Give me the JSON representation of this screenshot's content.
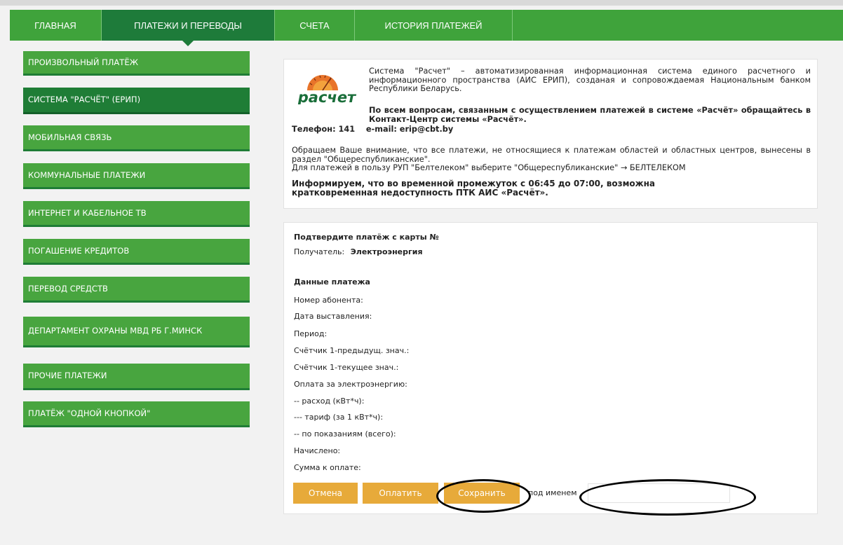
{
  "nav": {
    "tabs": [
      "ГЛАВНАЯ",
      "ПЛАТЕЖИ И ПЕРЕВОДЫ",
      "СЧЕТА",
      "ИСТОРИЯ ПЛАТЕЖЕЙ"
    ],
    "active": "ПЛАТЕЖИ И ПЕРЕВОДЫ"
  },
  "sidebar": {
    "items": [
      "ПРОИЗВОЛЬНЫЙ ПЛАТЁЖ",
      "СИСТЕМА \"РАСЧЁТ\" (ЕРИП)",
      "МОБИЛЬНАЯ СВЯЗЬ",
      "КОММУНАЛЬНЫЕ ПЛАТЕЖИ",
      "ИНТЕРНЕТ И КАБЕЛЬНОЕ ТВ",
      "ПОГАШЕНИЕ КРЕДИТОВ",
      "ПЕРЕВОД СРЕДСТВ",
      "ДЕПАРТАМЕНТ ОХРАНЫ МВД РБ Г.МИНСК",
      "ПРОЧИЕ ПЛАТЕЖИ",
      "ПЛАТЁЖ \"ОДНОЙ КНОПКОЙ\""
    ],
    "active": "СИСТЕМА \"РАСЧЁТ\" (ЕРИП)"
  },
  "info": {
    "logo_text": "расчет",
    "description": "Система \"Расчет\" – автоматизированная информационная система единого расчетного и информационного пространства (АИС ЕРИП), созданая и сопровождаемая Национальным банком Республики Беларусь.",
    "contact_bold": "По всем вопросам, связанным с осуществлением платежей в системе «Расчёт» обращайтесь в Контакт-Центр системы «Расчёт».",
    "phone_line": "Телефон: 141    e-mail: erip@cbt.by",
    "notice_1": "Обращаем Ваше внимание, что все платежи, не относящиеся к платежам областей и областных центров, вынесены в раздел \"Общереспубликанские\".",
    "notice_2": "Для платежей в пользу РУП \"Белтелеком\" выберите \"Общереспубликанские\" → БЕЛТЕЛЕКОМ",
    "maintenance": "Информируем, что во временной промежуток с 06:45 до 07:00, возможна кратковременная недоступность ПТК АИС «Расчёт»."
  },
  "confirm": {
    "title": "Подтвердите платёж с карты №",
    "recipient_label": "Получатель:",
    "recipient_value": "Электроэнергия",
    "section_title": "Данные платежа",
    "fields": [
      "Номер абонента:",
      "Дата выставления:",
      "Период:",
      "Счётчик 1-предыдущ. знач.:",
      "Счётчик 1-текущее знач.:",
      "Оплата за электроэнергию:",
      "-- расход (кВт*ч):",
      "--- тариф (за 1 кВт*ч):",
      "-- по показаниям (всего):",
      "Начислено:",
      "Сумма к оплате:"
    ],
    "buttons": {
      "cancel": "Отмена",
      "pay": "Оплатить",
      "save": "Сохранить"
    },
    "save_name_label": "под именем",
    "save_name_value": ""
  },
  "colors": {
    "nav_green": "#3fa33b",
    "active_green": "#1e7b3a",
    "button_orange": "#e7aa3a"
  }
}
